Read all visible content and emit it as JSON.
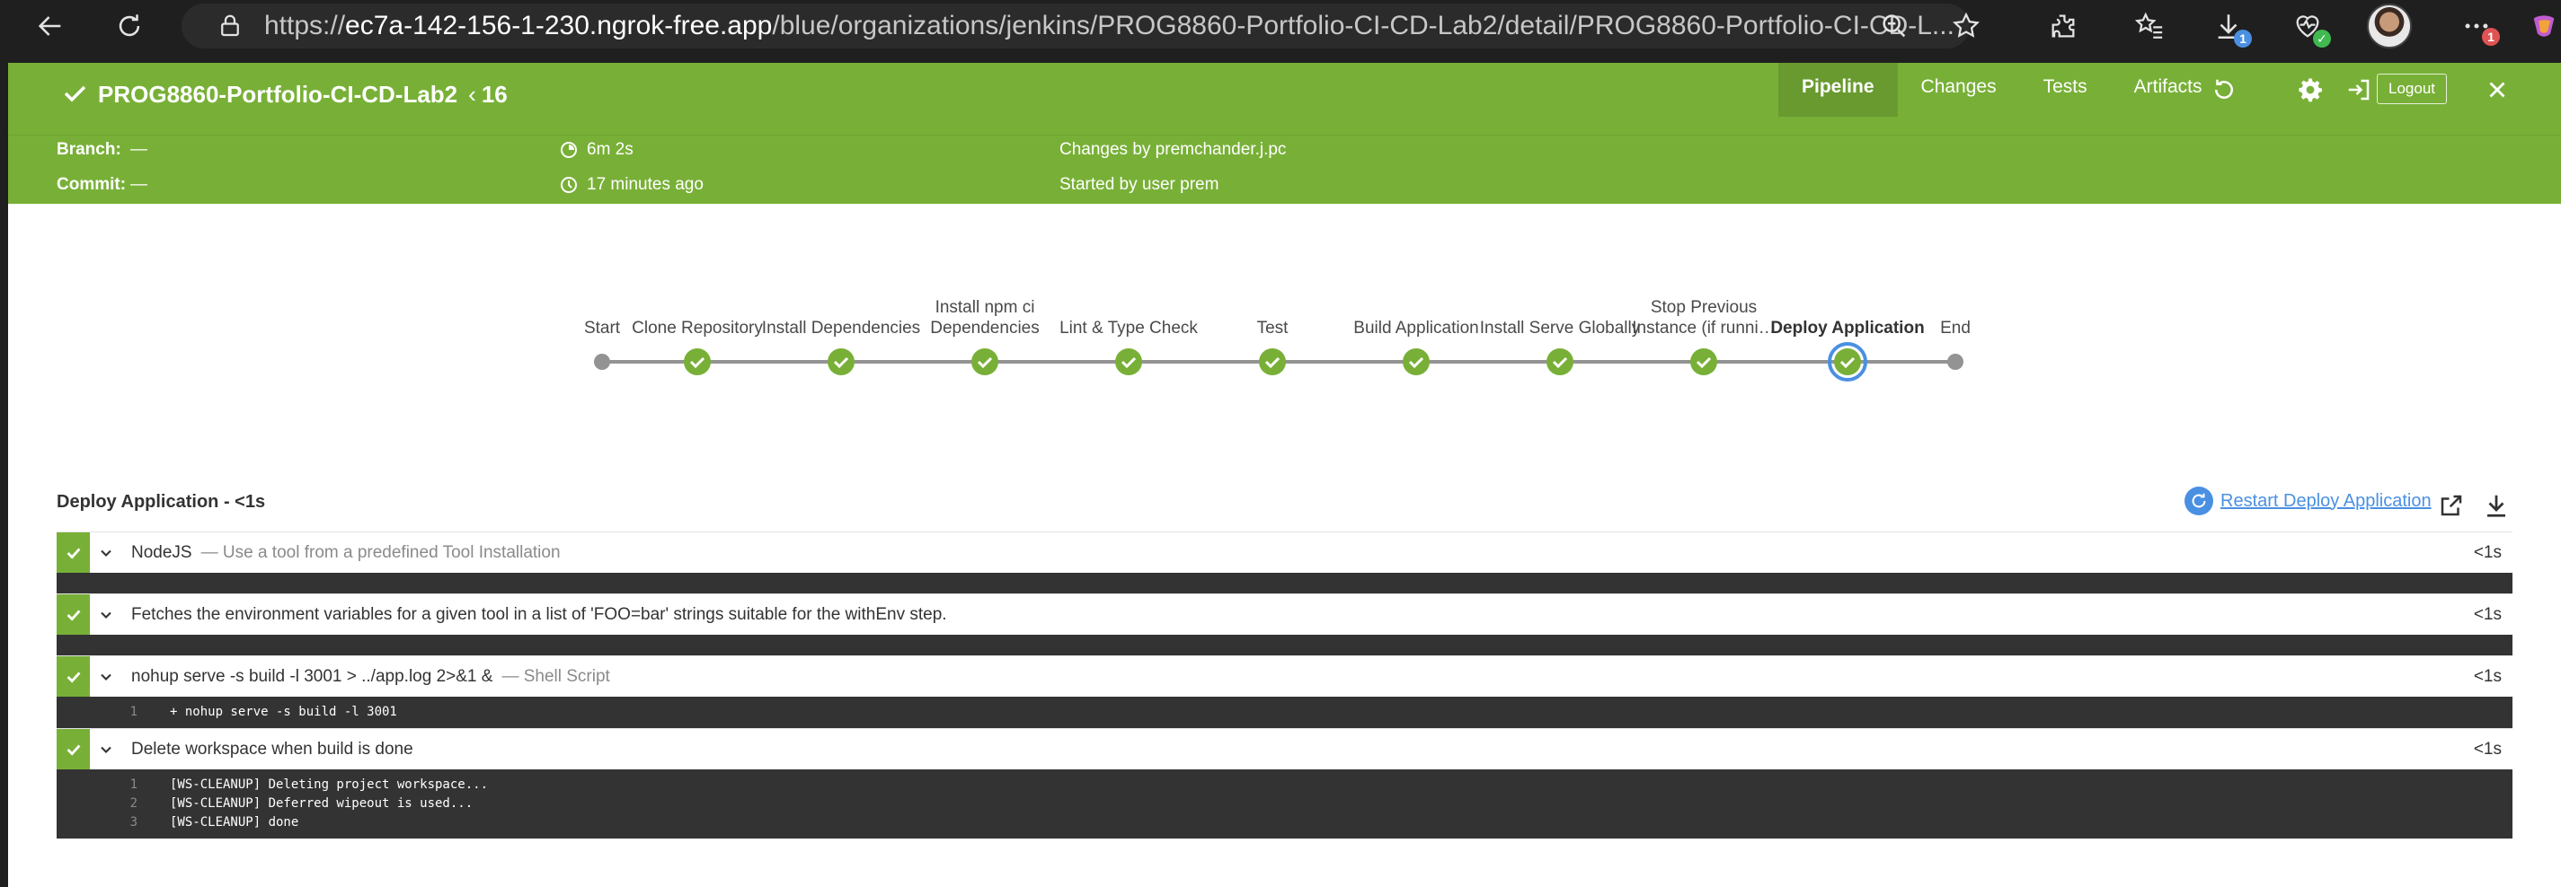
{
  "browser": {
    "url_scheme": "https://",
    "url_host": "ec7a-142-156-1-230.ngrok-free.app",
    "url_path": "/blue/organizations/jenkins/PROG8860-Portfolio-CI-CD-Lab2/detail/PROG8860-Portfolio-CI-CD-L...",
    "downloads_badge": "1",
    "menu_badge": "1"
  },
  "header": {
    "job_name": "PROG8860-Portfolio-CI-CD-Lab2",
    "run_number": "16",
    "tabs": [
      {
        "label": "Pipeline",
        "active": true
      },
      {
        "label": "Changes",
        "active": false
      },
      {
        "label": "Tests",
        "active": false
      },
      {
        "label": "Artifacts",
        "active": false
      }
    ],
    "logout_label": "Logout",
    "branch_label": "Branch:",
    "branch_value": "—",
    "commit_label": "Commit:",
    "commit_value": "—",
    "duration": "6m 2s",
    "time_ago": "17 minutes ago",
    "changes_by": "Changes by premchander.j.pc",
    "started_by": "Started by user prem"
  },
  "pipeline": {
    "stages": [
      {
        "label": "Start",
        "type": "start"
      },
      {
        "label": "Clone Repository",
        "type": "success"
      },
      {
        "label": "Install Dependencies",
        "type": "success"
      },
      {
        "label": "Install npm ci Dependencies",
        "type": "success"
      },
      {
        "label": "Lint & Type Check",
        "type": "success"
      },
      {
        "label": "Test",
        "type": "success"
      },
      {
        "label": "Build Application",
        "type": "success"
      },
      {
        "label": "Install Serve Globally",
        "type": "success"
      },
      {
        "label": "Stop Previous Instance (if runni…",
        "type": "success"
      },
      {
        "label": "Deploy Application",
        "type": "selected"
      },
      {
        "label": "End",
        "type": "end"
      }
    ]
  },
  "log": {
    "title": "Deploy Application - <1s",
    "restart_label": "Restart Deploy Application",
    "steps": [
      {
        "title": "NodeJS",
        "desc": "— Use a tool from a predefined Tool Installation",
        "time": "<1s",
        "lines": []
      },
      {
        "title": "Fetches the environment variables for a given tool in a list of 'FOO=bar' strings suitable for the withEnv step.",
        "desc": "",
        "time": "<1s",
        "lines": []
      },
      {
        "title": "nohup serve -s build -l 3001 > ../app.log 2>&1 &",
        "desc": "— Shell Script",
        "time": "<1s",
        "lines": [
          {
            "num": "1",
            "text": "+ nohup serve -s build -l 3001"
          }
        ]
      },
      {
        "title": "Delete workspace when build is done",
        "desc": "",
        "time": "<1s",
        "lines": [
          {
            "num": "1",
            "text": "[WS-CLEANUP] Deleting project workspace..."
          },
          {
            "num": "2",
            "text": "[WS-CLEANUP] Deferred wipeout is used..."
          },
          {
            "num": "3",
            "text": "[WS-CLEANUP] done"
          }
        ]
      }
    ]
  },
  "colors": {
    "jenkins_green": "#78b037",
    "selected_ring": "#4a90e2",
    "connector_gray": "#949393",
    "console_bg": "#333333"
  }
}
